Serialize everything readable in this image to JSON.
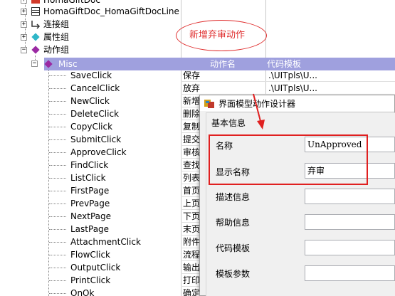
{
  "tree": {
    "top_items": [
      {
        "label": "HomaGiftDoc"
      },
      {
        "label": "HomaGiftDoc_HomaGiftDocLine"
      },
      {
        "label": "连接组"
      },
      {
        "label": "属性组"
      },
      {
        "label": "动作组"
      }
    ],
    "misc_group": {
      "label": "Misc",
      "col_action_name": "动作名",
      "col_template": "代码模板"
    },
    "actions": [
      {
        "name": "SaveClick",
        "action": "保存",
        "template": ".\\UITpls\\U..."
      },
      {
        "name": "CancelClick",
        "action": "放弃",
        "template": ".\\UITpls\\U..."
      },
      {
        "name": "NewClick",
        "action": "新增",
        "template": ""
      },
      {
        "name": "DeleteClick",
        "action": "删除",
        "template": ""
      },
      {
        "name": "CopyClick",
        "action": "复制",
        "template": ""
      },
      {
        "name": "SubmitClick",
        "action": "提交",
        "template": ""
      },
      {
        "name": "ApproveClick",
        "action": "审核",
        "template": ""
      },
      {
        "name": "FindClick",
        "action": "查找",
        "template": ""
      },
      {
        "name": "ListClick",
        "action": "列表",
        "template": ""
      },
      {
        "name": "FirstPage",
        "action": "首页",
        "template": ""
      },
      {
        "name": "PrevPage",
        "action": "上页",
        "template": ""
      },
      {
        "name": "NextPage",
        "action": "下页",
        "template": ""
      },
      {
        "name": "LastPage",
        "action": "末页",
        "template": ""
      },
      {
        "name": "AttachmentClick",
        "action": "附件",
        "template": ""
      },
      {
        "name": "FlowClick",
        "action": "流程",
        "template": ""
      },
      {
        "name": "OutputClick",
        "action": "输出",
        "template": ""
      },
      {
        "name": "PrintClick",
        "action": "打印",
        "template": ""
      },
      {
        "name": "OnOk",
        "action": "确定",
        "template": ""
      }
    ]
  },
  "annotation": {
    "text": "新增弃审动作",
    "color": "#e03030"
  },
  "dialog": {
    "title": "界面模型动作设计器",
    "group_title": "基本信息",
    "fields": [
      {
        "label": "名称",
        "value": "UnApproved"
      },
      {
        "label": "显示名称",
        "value": "弃审"
      },
      {
        "label": "描述信息",
        "value": ""
      },
      {
        "label": "帮助信息",
        "value": ""
      },
      {
        "label": "代码模板",
        "value": ""
      },
      {
        "label": "模板参数",
        "value": ""
      }
    ]
  },
  "colors": {
    "misc_header": "#9fa0de",
    "highlight_red": "#e02020",
    "action_icon": "#9b2aa3"
  }
}
